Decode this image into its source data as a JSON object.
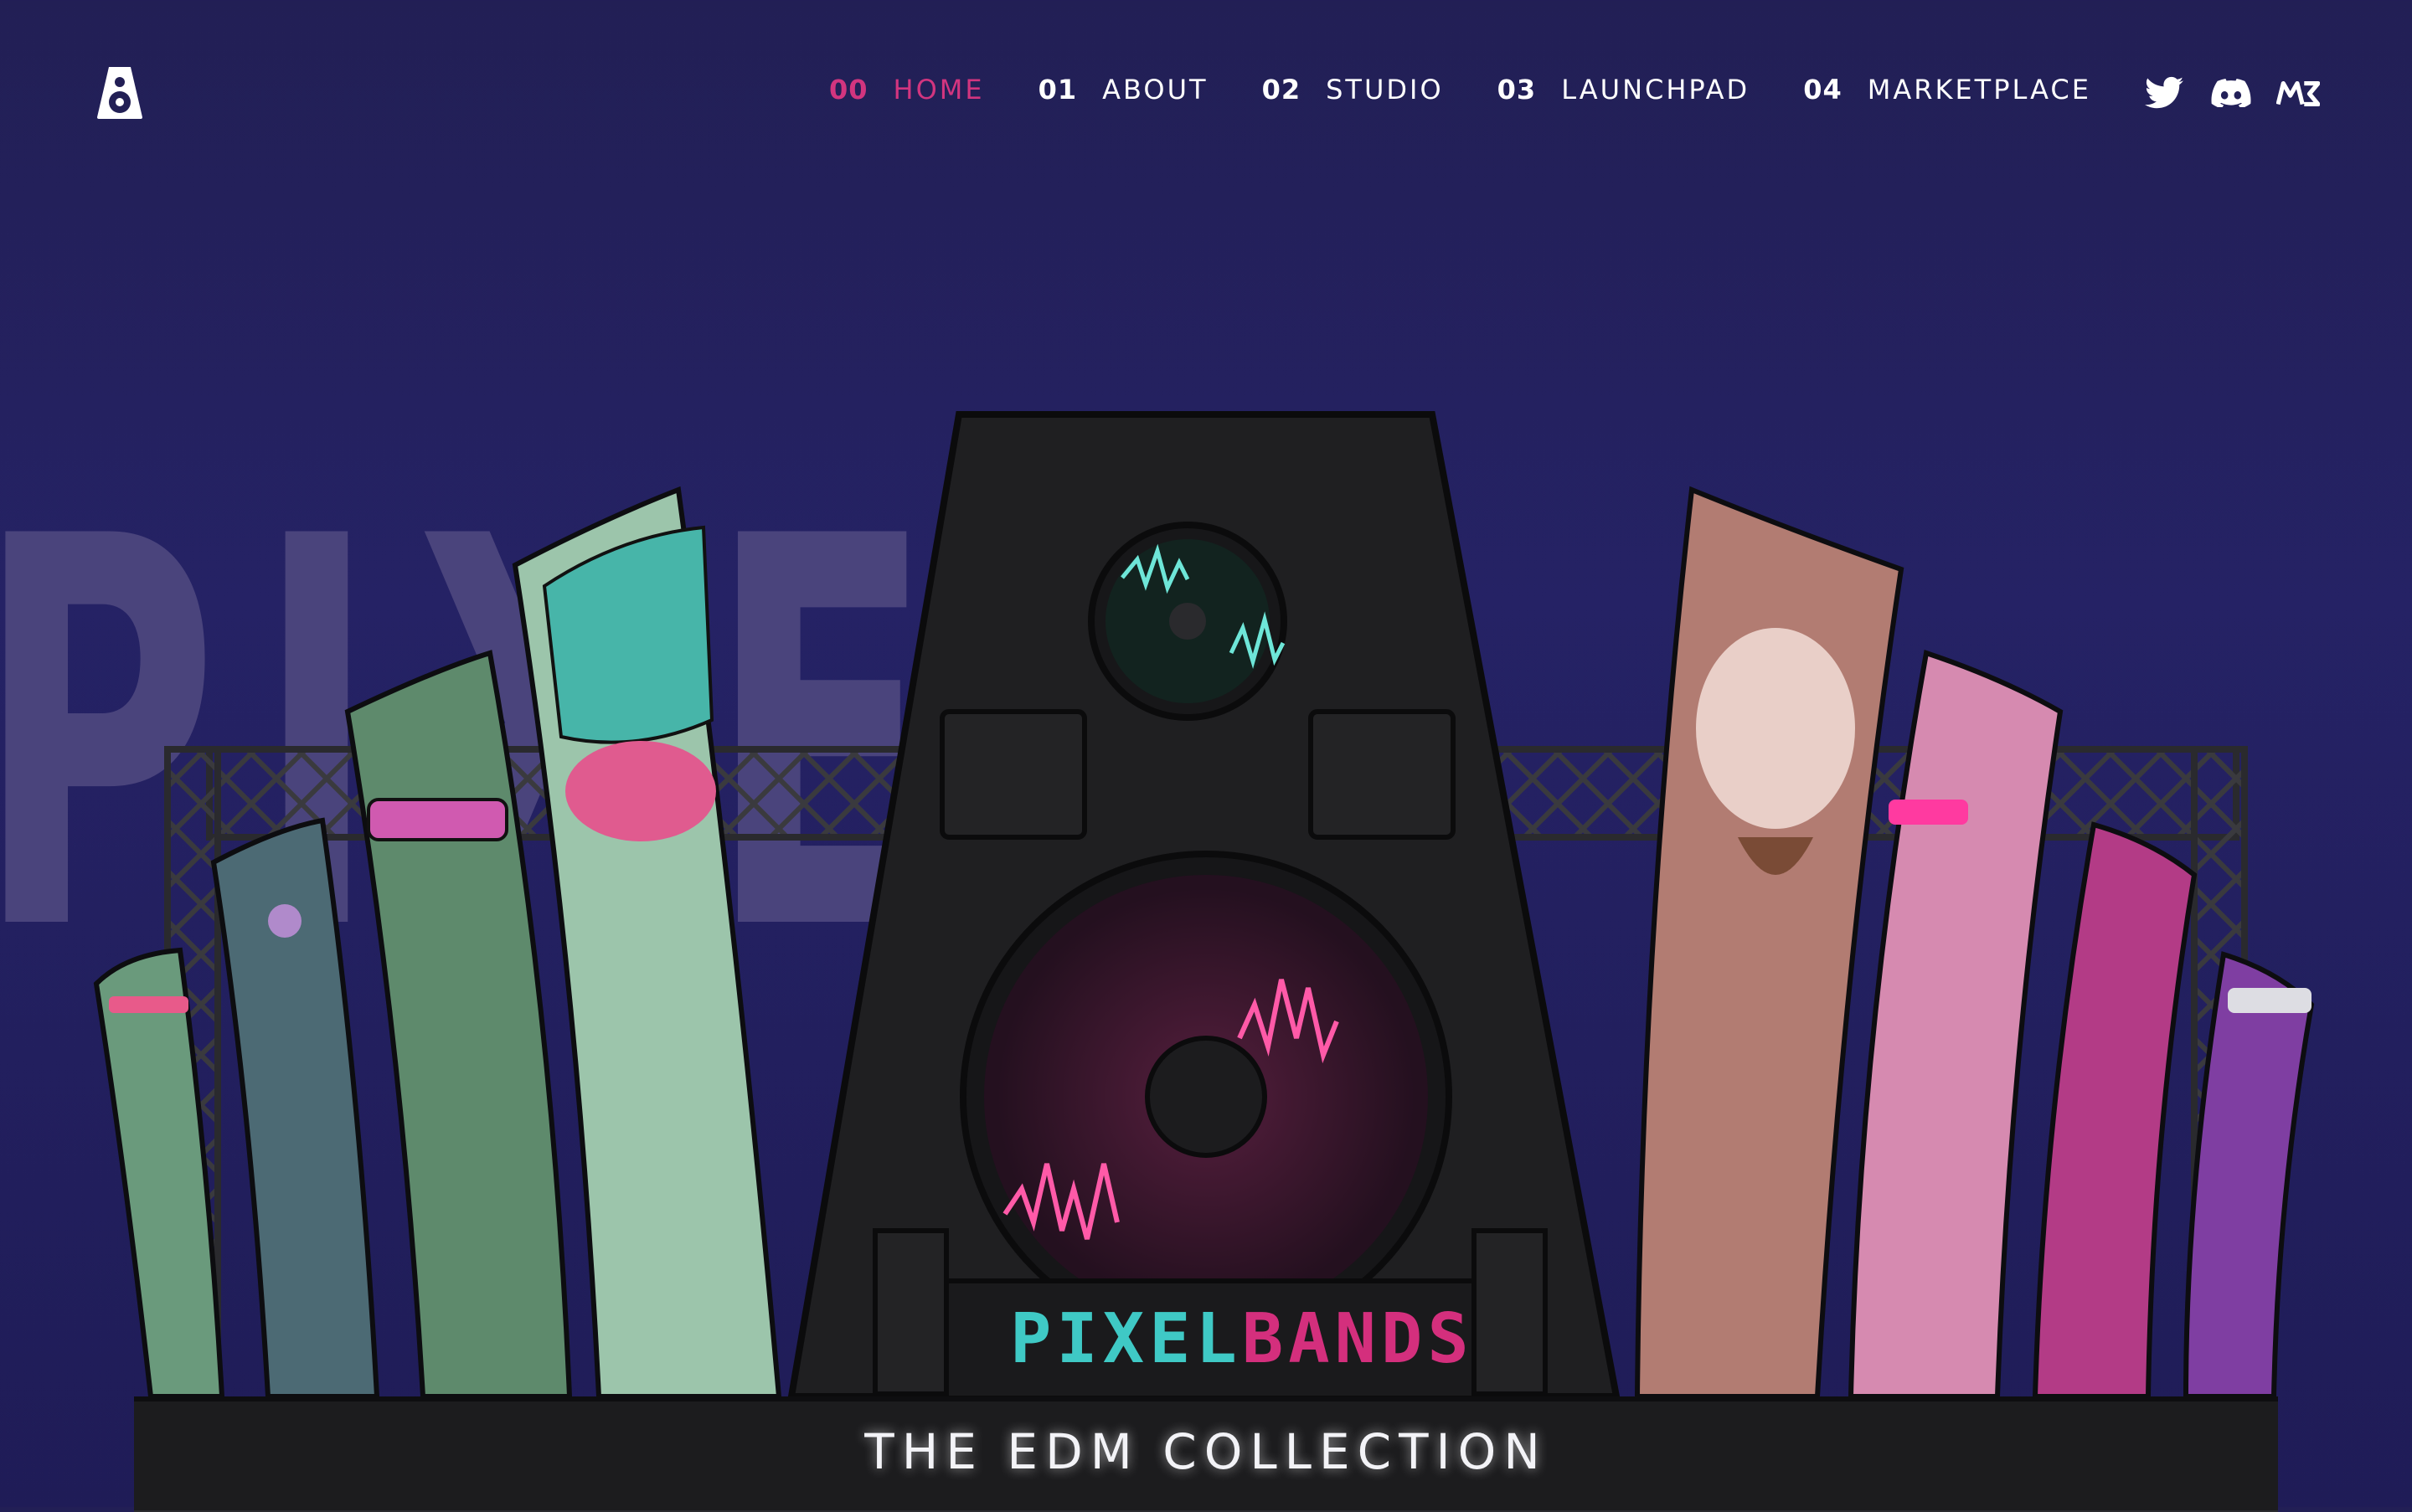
{
  "brand": {
    "logo_icon": "speaker-logo-icon",
    "name_part1": "PIXEL",
    "name_part2": "BANDS"
  },
  "nav": {
    "items": [
      {
        "num": "00",
        "label": "HOME",
        "active": true
      },
      {
        "num": "01",
        "label": "ABOUT",
        "active": false
      },
      {
        "num": "02",
        "label": "STUDIO",
        "active": false
      },
      {
        "num": "03",
        "label": "LAUNCHPAD",
        "active": false
      },
      {
        "num": "04",
        "label": "MARKETPLACE",
        "active": false
      }
    ]
  },
  "social": [
    {
      "icon": "twitter-icon"
    },
    {
      "icon": "discord-icon"
    },
    {
      "icon": "magic-eden-icon"
    }
  ],
  "hero": {
    "watermark": "PIXELBANDS",
    "subtitle": "THE EDM COLLECTION"
  },
  "colors": {
    "accent_pink": "#d2357f",
    "accent_teal": "#3fc9c5",
    "background": "#221f55"
  }
}
